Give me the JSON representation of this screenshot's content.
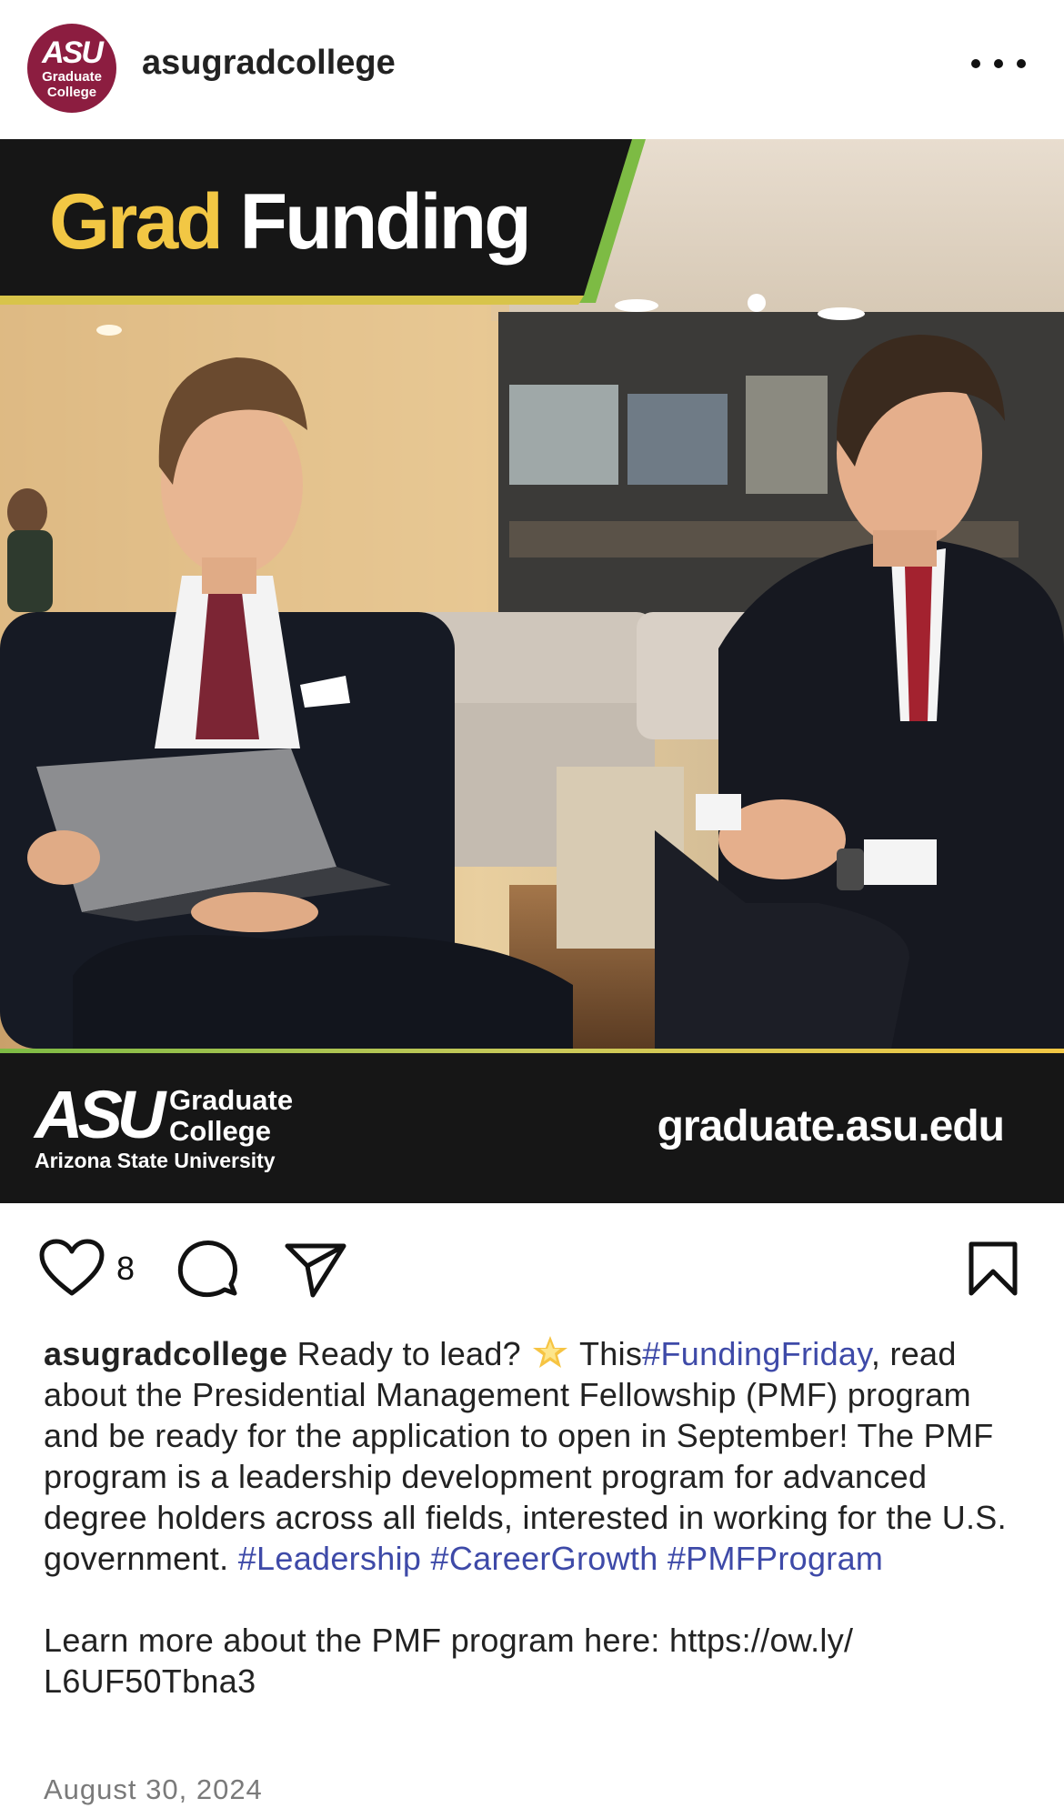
{
  "header": {
    "avatar": {
      "logo": "ASU",
      "line1": "Graduate",
      "line2": "College"
    },
    "username": "asugradcollege"
  },
  "image": {
    "banner_word1": "Grad",
    "banner_word2": "Funding",
    "logo_mark": "ASU",
    "logo_college_line1": "Graduate",
    "logo_college_line2": "College",
    "logo_university": "Arizona State University",
    "url": "graduate.asu.edu",
    "colors": {
      "gold": "#f2c744",
      "green": "#7dbb44",
      "maroon": "#8c1d40",
      "dark": "#161616"
    }
  },
  "actions": {
    "like_icon": "heart-icon",
    "like_count": "8",
    "comment_icon": "comment-icon",
    "share_icon": "send-icon",
    "save_icon": "bookmark-icon"
  },
  "caption": {
    "username": "asugradcollege",
    "text1": "Ready to lead?",
    "emoji": "glowing-star-emoji",
    "text2": "This",
    "tag1": "#FundingFriday",
    "text3": ", read about the Presidential Management Fellowship (PMF) program and be ready for the application to open in September! The PMF program is a leadership development program for advanced degree holders across all fields, interested in working for the U.S. government.",
    "tag2": "#Leadership",
    "tag3": "#CareerGrowth",
    "tag4": "#PMFProgram",
    "learn_more": "Learn more about the PMF program here: https://ow.ly/ L6UF50Tbna3"
  },
  "date": "August 30, 2024"
}
